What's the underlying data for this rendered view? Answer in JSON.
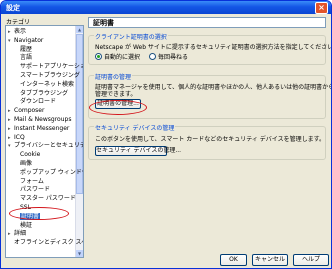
{
  "window": {
    "title": "設定"
  },
  "tree": {
    "label": "カテゴリ",
    "items": [
      {
        "label": "表示",
        "toggle": "+"
      },
      {
        "label": "Navigator",
        "toggle": "−"
      },
      {
        "label": "履歴",
        "toggle": ""
      },
      {
        "label": "言語",
        "toggle": ""
      },
      {
        "label": "サポートアプリケーション",
        "toggle": ""
      },
      {
        "label": "スマートブラウジング",
        "toggle": ""
      },
      {
        "label": "インターネット検索",
        "toggle": ""
      },
      {
        "label": "タブブラウジング",
        "toggle": ""
      },
      {
        "label": "ダウンロード",
        "toggle": ""
      },
      {
        "label": "Composer",
        "toggle": "+"
      },
      {
        "label": "Mail & Newsgroups",
        "toggle": "+"
      },
      {
        "label": "Instant Messenger",
        "toggle": "+"
      },
      {
        "label": "ICQ",
        "toggle": "+"
      },
      {
        "label": "プライバシーとセキュリティ",
        "toggle": "−"
      },
      {
        "label": "Cookie",
        "toggle": ""
      },
      {
        "label": "画像",
        "toggle": ""
      },
      {
        "label": "ポップアップ ウィンドウ",
        "toggle": ""
      },
      {
        "label": "フォーム",
        "toggle": ""
      },
      {
        "label": "パスワード",
        "toggle": ""
      },
      {
        "label": "マスター パスワード",
        "toggle": ""
      },
      {
        "label": "SSL",
        "toggle": ""
      },
      {
        "label": "証明書",
        "toggle": ""
      },
      {
        "label": "検証",
        "toggle": ""
      },
      {
        "label": "詳細",
        "toggle": "+"
      },
      {
        "label": "オフラインとディスク スペース",
        "toggle": ""
      }
    ]
  },
  "panel": {
    "header": "証明書",
    "client_group": {
      "legend": "クライアント証明書の選択",
      "desc": "Netscape が Web サイトに提示するセキュリティ証明書の選択方法を指定してください。",
      "opt_auto": "自動的に選択",
      "opt_ask": "毎回尋ねる"
    },
    "manage_group": {
      "legend": "証明書の管理",
      "desc1": "証明書マネージャを使用して、個人的な証明書やほかの人、他人あるいは他の証明書からの証明書を",
      "desc2": "管理できます。",
      "button": "証明書の管理..."
    },
    "device_group": {
      "legend": "セキュリティ デバイスの管理",
      "desc": "このボタンを使用して、スマート カードなどのセキュリティ デバイスを管理します。",
      "button": "セキュリティ デバイスの管理..."
    }
  },
  "footer": {
    "ok": "OK",
    "cancel": "キャンセル",
    "help": "ヘルプ"
  }
}
